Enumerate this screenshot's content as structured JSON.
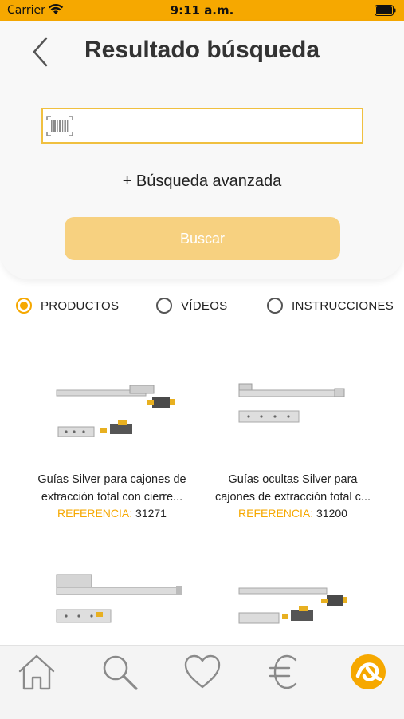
{
  "status_bar": {
    "carrier": "Carrier",
    "time": "9:11 a.m."
  },
  "header": {
    "title": "Resultado búsqueda",
    "back_icon": "chevron-left-icon"
  },
  "search": {
    "value": "",
    "placeholder": "",
    "barcode_icon": "barcode-icon",
    "advanced_label": "+ Búsqueda avanzada",
    "button_label": "Buscar"
  },
  "tabs": [
    {
      "label": "PRODUCTOS",
      "selected": true
    },
    {
      "label": "VÍDEOS",
      "selected": false
    },
    {
      "label": "INSTRUCCIONES",
      "selected": false
    }
  ],
  "products": [
    {
      "name_line1": "Guías Silver para cajones de",
      "name_line2": "extracción total con cierre...",
      "ref_label": "REFERENCIA:",
      "ref_value": "31271"
    },
    {
      "name_line1": "Guías ocultas Silver para",
      "name_line2": "cajones de extracción total c...",
      "ref_label": "REFERENCIA:",
      "ref_value": "31200"
    },
    {
      "name_line1": "",
      "name_line2": "",
      "ref_label": "",
      "ref_value": ""
    },
    {
      "name_line1": "",
      "name_line2": "",
      "ref_label": "",
      "ref_value": ""
    }
  ],
  "bottom_nav": [
    {
      "icon": "home-icon",
      "active": false
    },
    {
      "icon": "search-icon",
      "active": false
    },
    {
      "icon": "heart-icon",
      "active": false
    },
    {
      "icon": "euro-icon",
      "active": false
    },
    {
      "icon": "brand-logo-icon",
      "active": true
    }
  ],
  "colors": {
    "accent": "#f6a800",
    "button_disabled": "#f7d180",
    "panel_bg": "#f8f8f8"
  }
}
